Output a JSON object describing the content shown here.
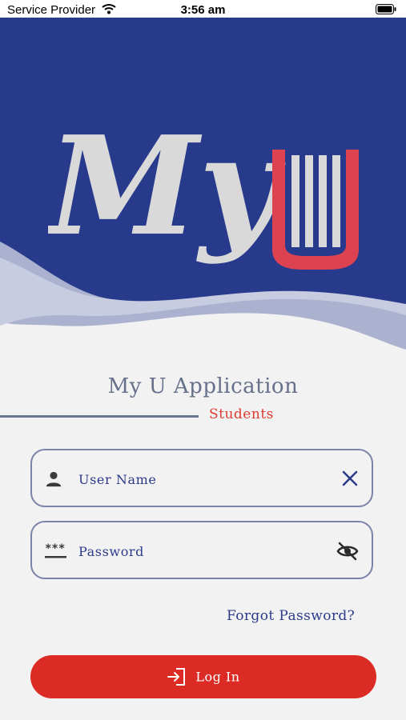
{
  "status_bar": {
    "carrier": "Service Provider",
    "time": "3:56 am",
    "icons": [
      "wifi-icon",
      "battery-icon"
    ]
  },
  "header": {
    "logo_text": "My U",
    "colors": {
      "primary": "#283a8c",
      "wave_light": "#aab2cf",
      "logo_gray": "#d9d9d9",
      "logo_red": "#dc4250"
    }
  },
  "main": {
    "title": "My U Application",
    "subtitle": "Students"
  },
  "form": {
    "username": {
      "value": "",
      "placeholder": "User Name",
      "leading_icon": "person-icon",
      "trailing_icon": "clear-icon"
    },
    "password": {
      "value": "",
      "placeholder": "Password",
      "leading_icon": "password-icon",
      "trailing_icon": "eye-off-icon"
    },
    "forgot_password": "Forgot Password?",
    "login_label": "Log In",
    "login_icon": "login-icon"
  },
  "accent_color": "#dc2b25"
}
